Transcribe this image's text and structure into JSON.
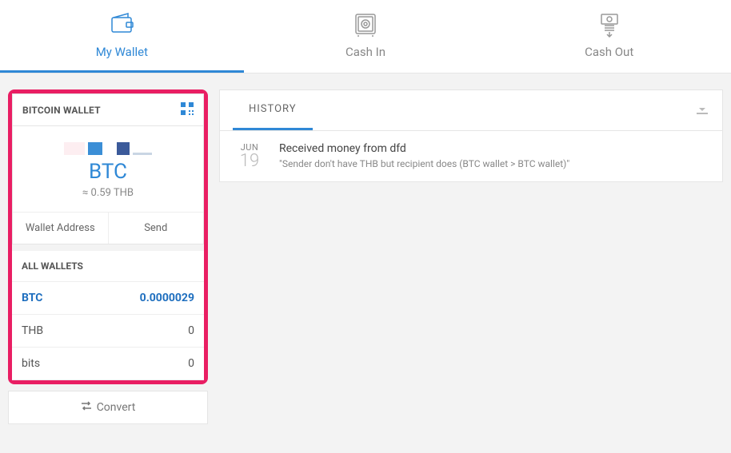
{
  "nav": {
    "my_wallet": "My Wallet",
    "cash_in": "Cash In",
    "cash_out": "Cash Out"
  },
  "wallet_panel": {
    "title": "BITCOIN WALLET",
    "currency": "BTC",
    "approx": "≈ 0.59 THB",
    "wallet_address_btn": "Wallet Address",
    "send_btn": "Send"
  },
  "all_wallets": {
    "title": "ALL WALLETS",
    "rows": [
      {
        "name": "BTC",
        "value": "0.0000029",
        "active": true
      },
      {
        "name": "THB",
        "value": "0",
        "active": false
      },
      {
        "name": "bits",
        "value": "0",
        "active": false
      }
    ]
  },
  "convert_label": "Convert",
  "history": {
    "tab": "HISTORY",
    "items": [
      {
        "month": "JUN",
        "day": "19",
        "title": "Received money from dfd",
        "desc": "\"Sender don't have THB but recipient does (BTC wallet > BTC wallet)\""
      }
    ]
  }
}
